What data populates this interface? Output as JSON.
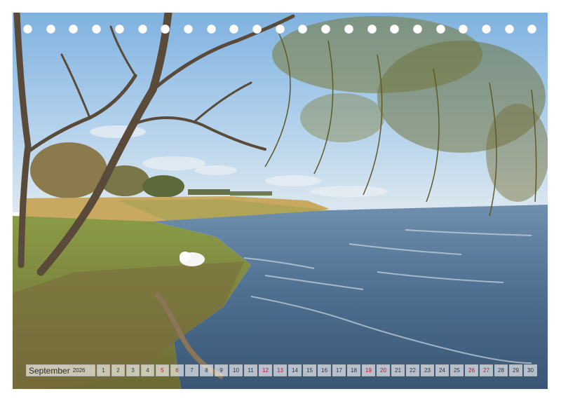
{
  "calendar": {
    "month": "September",
    "year": "2026",
    "days": [
      {
        "n": "1",
        "red": false
      },
      {
        "n": "2",
        "red": false
      },
      {
        "n": "3",
        "red": false
      },
      {
        "n": "4",
        "red": false
      },
      {
        "n": "5",
        "red": true
      },
      {
        "n": "6",
        "red": true
      },
      {
        "n": "7",
        "red": false
      },
      {
        "n": "8",
        "red": false
      },
      {
        "n": "9",
        "red": false
      },
      {
        "n": "10",
        "red": false
      },
      {
        "n": "11",
        "red": false
      },
      {
        "n": "12",
        "red": true
      },
      {
        "n": "13",
        "red": true
      },
      {
        "n": "14",
        "red": false
      },
      {
        "n": "15",
        "red": false
      },
      {
        "n": "16",
        "red": false
      },
      {
        "n": "17",
        "red": false
      },
      {
        "n": "18",
        "red": false
      },
      {
        "n": "19",
        "red": true
      },
      {
        "n": "20",
        "red": true
      },
      {
        "n": "21",
        "red": false
      },
      {
        "n": "22",
        "red": false
      },
      {
        "n": "23",
        "red": false
      },
      {
        "n": "24",
        "red": false
      },
      {
        "n": "25",
        "red": false
      },
      {
        "n": "26",
        "red": true
      },
      {
        "n": "27",
        "red": true
      },
      {
        "n": "28",
        "red": false
      },
      {
        "n": "29",
        "red": false
      },
      {
        "n": "30",
        "red": false
      }
    ],
    "weekend_color": "#c8102e"
  },
  "binding_holes": 23,
  "photo": {
    "subject": "lakeshore-with-swan",
    "colors": {
      "sky": "#b6d3ec",
      "water": "#4d6e8f",
      "grass": "#7d8f3e",
      "reeds": "#c9a860"
    }
  }
}
